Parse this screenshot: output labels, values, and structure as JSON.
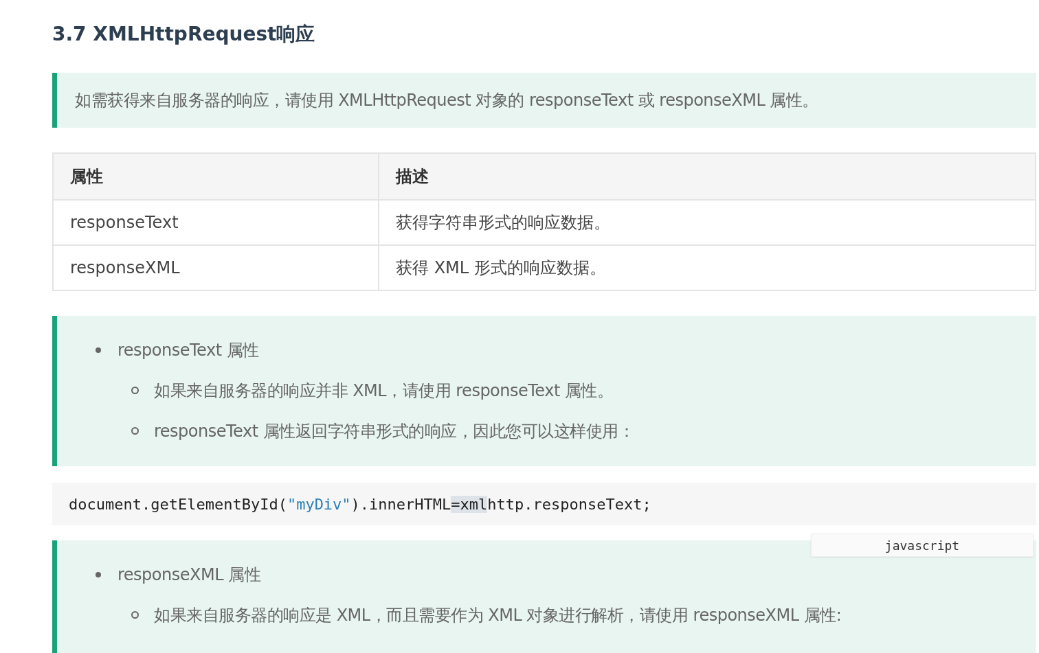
{
  "heading": "3.7 XMLHttpRequest响应",
  "intro": "如需获得来自服务器的响应，请使用 XMLHttpRequest 对象的 responseText 或 responseXML 属性。",
  "table": {
    "columns": [
      "属性",
      "描述"
    ],
    "rows": [
      [
        "responseText",
        "获得字符串形式的响应数据。"
      ],
      [
        "responseXML",
        "获得 XML 形式的响应数据。"
      ]
    ]
  },
  "note_1": {
    "items": [
      {
        "text": "responseText 属性",
        "children": [
          {
            "text": "如果来自服务器的响应并非 XML，请使用 responseText 属性。"
          },
          {
            "text": "responseText 属性返回字符串形式的响应，因此您可以这样使用："
          }
        ]
      }
    ]
  },
  "code": {
    "language": "javascript",
    "tokens": [
      {
        "kind": "plain",
        "text": "document.getElementById("
      },
      {
        "kind": "string",
        "text": "\"myDiv\""
      },
      {
        "kind": "plain",
        "text": ").innerHTML"
      },
      {
        "kind": "highlight",
        "text": "=xml"
      },
      {
        "kind": "plain",
        "text": "http.responseText;"
      }
    ]
  },
  "note_2": {
    "items": [
      {
        "text": "responseXML 属性",
        "children": [
          {
            "text": "如果来自服务器的响应是 XML，而且需要作为 XML 对象进行解析，请使用 responseXML 属性:"
          }
        ]
      }
    ]
  }
}
